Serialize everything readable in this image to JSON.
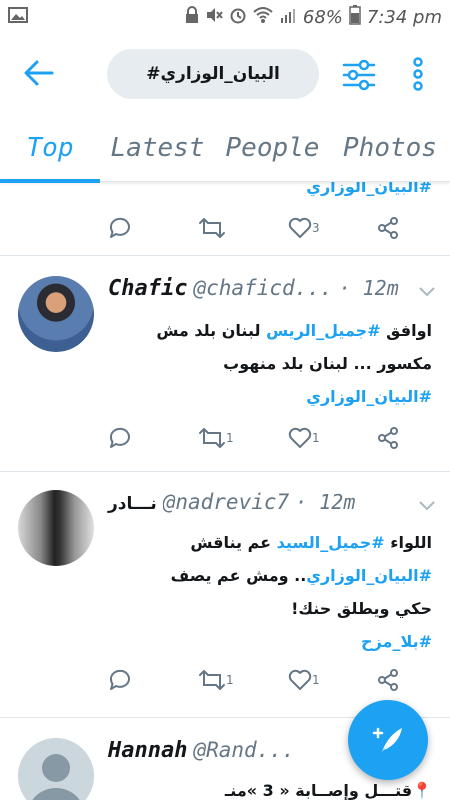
{
  "status_bar": {
    "battery": "68%",
    "time": "7:34 pm"
  },
  "search": {
    "query": "#البيان_الوزاري"
  },
  "tabs": [
    "Top",
    "Latest",
    "People",
    "Photos"
  ],
  "colors": {
    "accent": "#1da1f2",
    "muted": "#657786",
    "search_bg": "#e6ecf0"
  },
  "tweets": [
    {
      "partial_tag": "#البيان_الوزاري",
      "replies": "",
      "retweets": "",
      "likes": "3"
    },
    {
      "name": "Chafic",
      "handle": "@chaficd...",
      "time": "· 12m",
      "lines": [
        [
          {
            "t": "اوافق "
          },
          {
            "t": "#جميل_الريس",
            "tag": true
          },
          {
            "t": " لبنان بلد مش"
          }
        ],
        [
          {
            "t": "مكسور ... لبنان بلد منهوب"
          }
        ],
        [
          {
            "t": "#البيان_الوزاري",
            "tag": true
          }
        ]
      ],
      "replies": "",
      "retweets": "1",
      "likes": "1"
    },
    {
      "name": "نـــادر",
      "handle": "@nadrevic7",
      "time": "· 12m",
      "lines": [
        [
          {
            "t": "اللواء "
          },
          {
            "t": "#جميل_السيد",
            "tag": true
          },
          {
            "t": " عم يناقش"
          }
        ],
        [
          {
            "t": "#البيان_الوزاري",
            "tag": true
          },
          {
            "t": ".. ومش عم يصف"
          }
        ],
        [
          {
            "t": "حكي ويطلق حنك!"
          }
        ],
        [
          {
            "t": "#بلا_مزح",
            "tag": true
          }
        ]
      ],
      "replies": "",
      "retweets": "1",
      "likes": "1"
    },
    {
      "name": "Hannah",
      "handle": "@Rand...",
      "time": "",
      "lines": [
        [
          {
            "t": "📍قتـــل وإصــابة « 3 »منـ"
          }
        ]
      ]
    }
  ]
}
